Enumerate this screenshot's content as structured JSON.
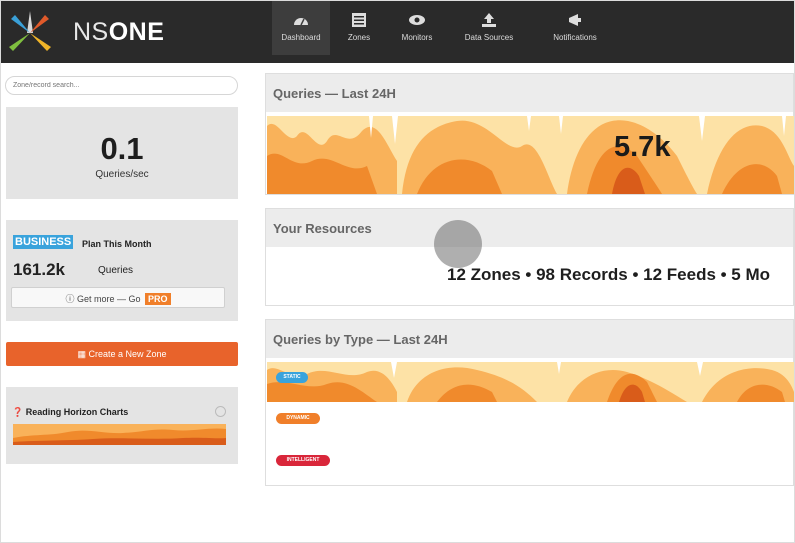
{
  "app": {
    "brand_light": "NS",
    "brand_bold": "ONE"
  },
  "nav": [
    {
      "label": "Dashboard",
      "icon": "dashboard-gauge-icon",
      "active": true
    },
    {
      "label": "Zones",
      "icon": "zones-list-icon"
    },
    {
      "label": "Monitors",
      "icon": "monitors-eye-icon"
    },
    {
      "label": "Data Sources",
      "icon": "data-sources-upload-icon"
    },
    {
      "label": "Notifications",
      "icon": "notifications-megaphone-icon"
    }
  ],
  "search": {
    "placeholder": "Zone/record search..."
  },
  "qps": {
    "value": "0.1",
    "label": "Queries/sec"
  },
  "plan": {
    "badge": "BUSINESS",
    "title": "Plan This Month",
    "queries_value": "161.2k",
    "queries_label": "Queries",
    "getmore_label": "Get more — Go",
    "pro_badge": "PRO"
  },
  "create_zone": {
    "label": "Create a New Zone"
  },
  "horizon_help": {
    "title": "Reading Horizon Charts"
  },
  "cards": {
    "queries_24h": {
      "title": "Queries — Last 24H",
      "value": "5.7k"
    },
    "resources": {
      "title": "Your Resources",
      "summary": "12 Zones • 98 Records • 12 Feeds • 5 Mo"
    },
    "by_type": {
      "title": "Queries by Type — Last 24H",
      "types": [
        {
          "label": "STATIC",
          "color": "#39a3dc"
        },
        {
          "label": "DYNAMIC",
          "color": "#f07f2a"
        },
        {
          "label": "INTELLIGENT",
          "color": "#d9263a"
        }
      ]
    }
  },
  "colors": {
    "accent": "#e8632b",
    "horizon_light": "#fde2a6",
    "horizon_mid": "#f9b25a",
    "horizon_dark": "#f08a2c",
    "horizon_peak": "#d95c1a"
  }
}
